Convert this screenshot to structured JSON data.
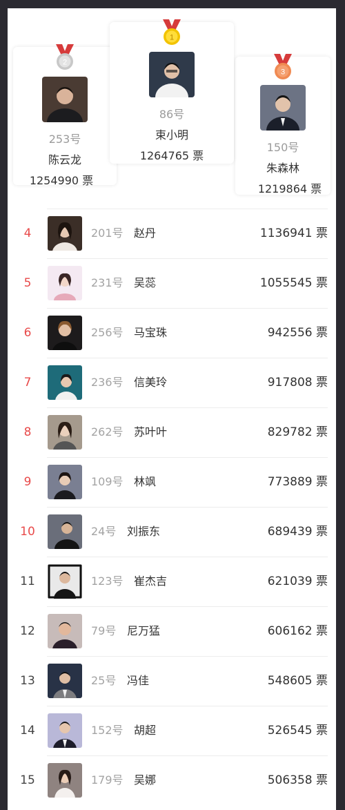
{
  "podium": {
    "first": {
      "rank_badge": "1",
      "number": "86号",
      "name": "束小明",
      "votes": "1264765 票",
      "medal_color": "#f2c300",
      "avatar_bg": "#2f3a4a"
    },
    "second": {
      "rank_badge": "2",
      "number": "253号",
      "name": "陈云龙",
      "votes": "1254990 票",
      "medal_color": "#c8c8c8",
      "avatar_bg": "#4a3b33"
    },
    "third": {
      "rank_badge": "3",
      "number": "150号",
      "name": "朱森林",
      "votes": "1219864 票",
      "medal_color": "#f08a52",
      "avatar_bg": "#6c7384"
    }
  },
  "ribbon_color": "#d63b3b",
  "list": [
    {
      "rank": "4",
      "number": "201号",
      "name": "赵丹",
      "votes": "1136941 票",
      "highlight": true,
      "avatar_bg": "#3b2e27"
    },
    {
      "rank": "5",
      "number": "231号",
      "name": "吴蕊",
      "votes": "1055545 票",
      "highlight": true,
      "avatar_bg": "#f4e9f2"
    },
    {
      "rank": "6",
      "number": "256号",
      "name": "马宝珠",
      "votes": "942556 票",
      "highlight": true,
      "avatar_bg": "#1d1b1c"
    },
    {
      "rank": "7",
      "number": "236号",
      "name": "信美玲",
      "votes": "917808 票",
      "highlight": true,
      "avatar_bg": "#1e6b79"
    },
    {
      "rank": "8",
      "number": "262号",
      "name": "苏叶叶",
      "votes": "829782 票",
      "highlight": true,
      "avatar_bg": "#a59a8d"
    },
    {
      "rank": "9",
      "number": "109号",
      "name": "林飒",
      "votes": "773889 票",
      "highlight": true,
      "avatar_bg": "#7a7f92"
    },
    {
      "rank": "10",
      "number": "24号",
      "name": "刘振东",
      "votes": "689439 票",
      "highlight": true,
      "avatar_bg": "#6a6e7a"
    },
    {
      "rank": "11",
      "number": "123号",
      "name": "崔杰吉",
      "votes": "621039 票",
      "highlight": false,
      "avatar_bg": "#d9d9d9"
    },
    {
      "rank": "12",
      "number": "79号",
      "name": "尼万猛",
      "votes": "606162 票",
      "highlight": false,
      "avatar_bg": "#c7bbb9"
    },
    {
      "rank": "13",
      "number": "25号",
      "name": "冯佳",
      "votes": "548605 票",
      "highlight": false,
      "avatar_bg": "#283246"
    },
    {
      "rank": "14",
      "number": "152号",
      "name": "胡超",
      "votes": "526545 票",
      "highlight": false,
      "avatar_bg": "#b9b8d8"
    },
    {
      "rank": "15",
      "number": "179号",
      "name": "吴娜",
      "votes": "506358 票",
      "highlight": false,
      "avatar_bg": "#8f8380"
    }
  ]
}
